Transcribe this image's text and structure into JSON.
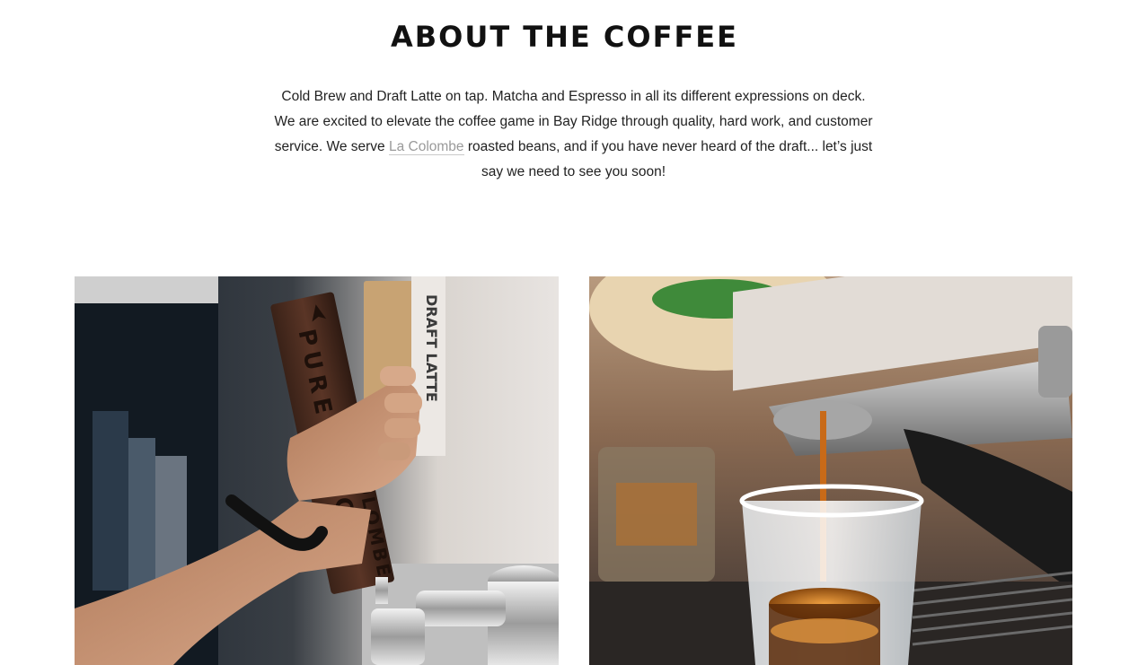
{
  "section": {
    "title": "ABOUT THE COFFEE"
  },
  "intro": {
    "text_before_link": "Cold Brew and Draft Latte on tap. Matcha and Espresso in all its different expressions on deck. We are excited to elevate the coffee game in Bay Ridge through quality, hard work, and customer service. We serve ",
    "link_text": "La Colombe",
    "text_after_link": " roasted beans, and if you have never heard of the draft... let’s just say we need to see you soon!"
  },
  "photos": [
    {
      "name": "draft-tap-photo",
      "tap_handle_text": "PURE BLACK",
      "tap_handle_brand": "LA COLOMBE",
      "background_tap_text": "DRAFT LATTE"
    },
    {
      "name": "espresso-shot-photo"
    }
  ],
  "colors": {
    "title": "#111111",
    "body_text": "#222222",
    "link": "#9a9a9a",
    "background": "#ffffff"
  }
}
